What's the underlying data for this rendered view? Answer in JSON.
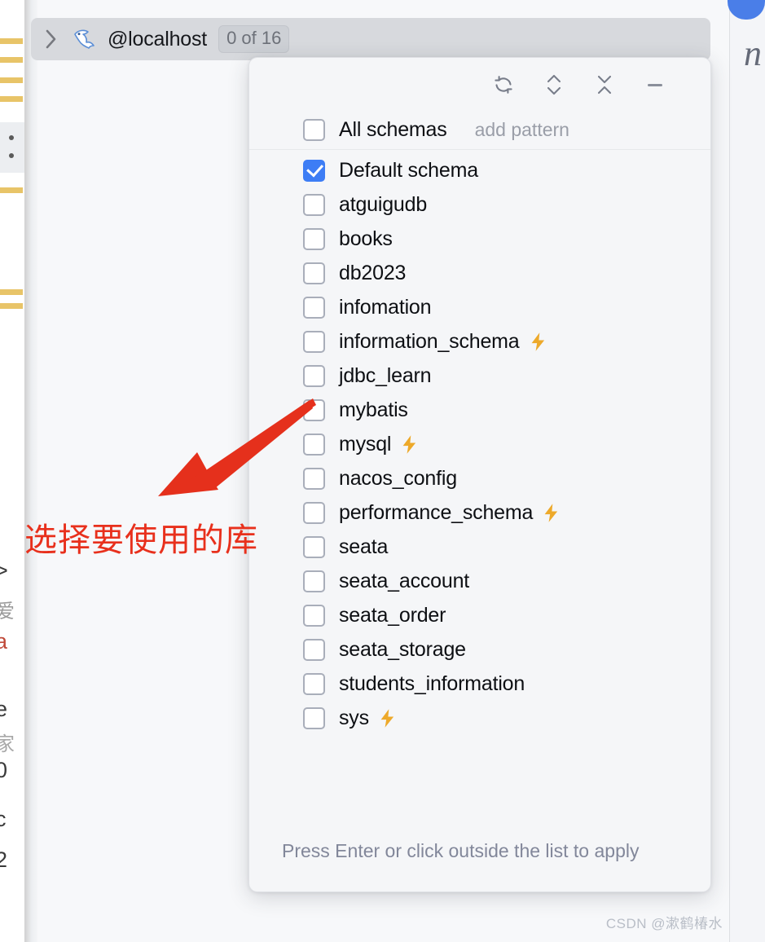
{
  "breadcrumb": {
    "expand_icon": "chevron-right-icon",
    "db_icon": "mysql-dolphin-icon",
    "title": "@localhost",
    "count_badge": "0 of 16"
  },
  "popup": {
    "toolbar": [
      {
        "name": "refresh-button",
        "icon": "refresh-icon",
        "title": "Refresh"
      },
      {
        "name": "expand-button",
        "icon": "chevron-up-down-icon",
        "title": "Expand"
      },
      {
        "name": "collapse-button",
        "icon": "collapse-icon",
        "title": "Collapse"
      },
      {
        "name": "minimize-button",
        "icon": "minus-icon",
        "title": "Minimize"
      }
    ],
    "all_schemas": {
      "label": "All schemas",
      "checked": false,
      "add_pattern_label": "add pattern"
    },
    "schemas": [
      {
        "label": "Default schema",
        "checked": true,
        "bolt": false
      },
      {
        "label": "atguigudb",
        "checked": false,
        "bolt": false
      },
      {
        "label": "books",
        "checked": false,
        "bolt": false
      },
      {
        "label": "db2023",
        "checked": false,
        "bolt": false
      },
      {
        "label": "infomation",
        "checked": false,
        "bolt": false
      },
      {
        "label": "information_schema",
        "checked": false,
        "bolt": true
      },
      {
        "label": "jdbc_learn",
        "checked": false,
        "bolt": false
      },
      {
        "label": "mybatis",
        "checked": false,
        "bolt": false
      },
      {
        "label": "mysql",
        "checked": false,
        "bolt": true
      },
      {
        "label": "nacos_config",
        "checked": false,
        "bolt": false
      },
      {
        "label": "performance_schema",
        "checked": false,
        "bolt": true
      },
      {
        "label": "seata",
        "checked": false,
        "bolt": false
      },
      {
        "label": "seata_account",
        "checked": false,
        "bolt": false
      },
      {
        "label": "seata_order",
        "checked": false,
        "bolt": false
      },
      {
        "label": "seata_storage",
        "checked": false,
        "bolt": false
      },
      {
        "label": "students_information",
        "checked": false,
        "bolt": false
      },
      {
        "label": "sys",
        "checked": false,
        "bolt": true
      }
    ],
    "footer_hint": "Press Enter or click outside the list to apply"
  },
  "annotation": {
    "text": "选择要使用的库",
    "color": "#e8301c",
    "arrow": "red-arrow-pointing-up-right"
  },
  "background": {
    "right_letter": "n",
    "left_glyphs": [
      ">",
      "爱",
      "a",
      "e",
      "家",
      "0",
      "c",
      "2"
    ]
  },
  "watermark": "CSDN @漱鹤椿水",
  "colors": {
    "accent_blue": "#3d7df5",
    "bolt_amber": "#eda92a",
    "annotation_red": "#e8301c",
    "popup_bg": "#f5f6f8",
    "breadcrumb_bg": "#d7d9dd"
  }
}
